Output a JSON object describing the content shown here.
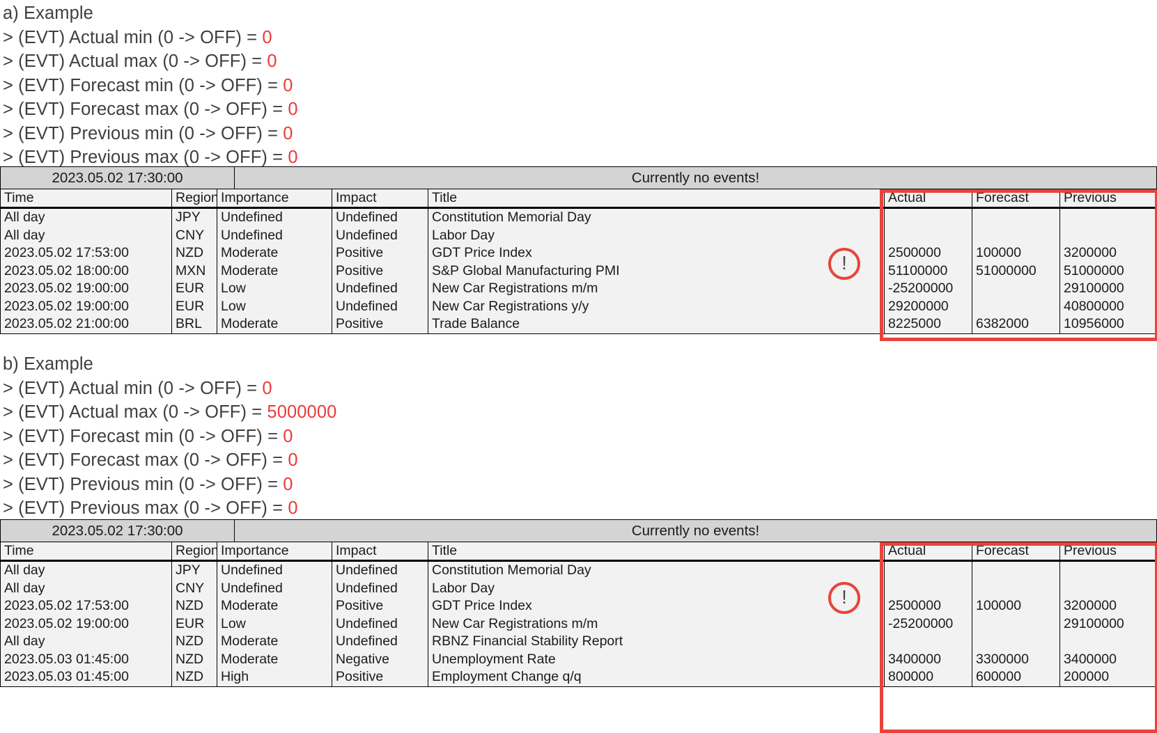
{
  "sections": [
    {
      "caption": "a) Example",
      "loglines": [
        {
          "label": "> (EVT) Actual min (0 -> OFF) = ",
          "value": "0"
        },
        {
          "label": "> (EVT) Actual max (0 -> OFF) = ",
          "value": "0"
        },
        {
          "label": "> (EVT) Forecast min (0 -> OFF) = ",
          "value": "0"
        },
        {
          "label": "> (EVT) Forecast max (0 -> OFF) = ",
          "value": "0"
        },
        {
          "label": "> (EVT) Previous min (0 -> OFF) = ",
          "value": "0"
        },
        {
          "label": "> (EVT) Previous max (0 -> OFF) = ",
          "value": "0"
        }
      ],
      "table": {
        "clock": "2023.05.02 17:30:00",
        "status": "Currently no events!",
        "headers": {
          "time": "Time",
          "region": "Region",
          "importance": "Importance",
          "impact": "Impact",
          "title": "Title",
          "actual": "Actual",
          "forecast": "Forecast",
          "previous": "Previous"
        },
        "rows": [
          {
            "time": "All day",
            "region": "JPY",
            "importance": "Undefined",
            "impact": "Undefined",
            "title": "Constitution Memorial Day",
            "actual": "",
            "forecast": "",
            "previous": ""
          },
          {
            "time": "All day",
            "region": "CNY",
            "importance": "Undefined",
            "impact": "Undefined",
            "title": "Labor Day",
            "actual": "",
            "forecast": "",
            "previous": ""
          },
          {
            "time": "2023.05.02 17:53:00",
            "region": "NZD",
            "importance": "Moderate",
            "impact": "Positive",
            "title": "GDT Price Index",
            "actual": "2500000",
            "forecast": "100000",
            "previous": "3200000"
          },
          {
            "time": "2023.05.02 18:00:00",
            "region": "MXN",
            "importance": "Moderate",
            "impact": "Positive",
            "title": "S&P Global Manufacturing PMI",
            "actual": "51100000",
            "forecast": "51000000",
            "previous": "51000000"
          },
          {
            "time": "2023.05.02 19:00:00",
            "region": "EUR",
            "importance": "Low",
            "impact": "Undefined",
            "title": "New Car Registrations m/m",
            "actual": "-25200000",
            "forecast": "",
            "previous": "29100000"
          },
          {
            "time": "2023.05.02 19:00:00",
            "region": "EUR",
            "importance": "Low",
            "impact": "Undefined",
            "title": "New Car Registrations y/y",
            "actual": "29200000",
            "forecast": "",
            "previous": "40800000"
          },
          {
            "time": "2023.05.02 21:00:00",
            "region": "BRL",
            "importance": "Moderate",
            "impact": "Positive",
            "title": "Trade Balance",
            "actual": "8225000",
            "forecast": "6382000",
            "previous": "10956000"
          }
        ],
        "warning_icon": "warning-exclamation-icon",
        "warning_glyph": "!"
      }
    },
    {
      "caption": "b) Example",
      "loglines": [
        {
          "label": "> (EVT) Actual min (0 -> OFF) = ",
          "value": "0"
        },
        {
          "label": "> (EVT) Actual max (0 -> OFF) = ",
          "value": "5000000"
        },
        {
          "label": "> (EVT) Forecast min (0 -> OFF) = ",
          "value": "0"
        },
        {
          "label": "> (EVT) Forecast max (0 -> OFF) = ",
          "value": "0"
        },
        {
          "label": "> (EVT) Previous min (0 -> OFF) = ",
          "value": "0"
        },
        {
          "label": "> (EVT) Previous max (0 -> OFF) = ",
          "value": "0"
        }
      ],
      "table": {
        "clock": "2023.05.02 17:30:00",
        "status": "Currently no events!",
        "headers": {
          "time": "Time",
          "region": "Region",
          "importance": "Importance",
          "impact": "Impact",
          "title": "Title",
          "actual": "Actual",
          "forecast": "Forecast",
          "previous": "Previous"
        },
        "rows": [
          {
            "time": "All day",
            "region": "JPY",
            "importance": "Undefined",
            "impact": "Undefined",
            "title": "Constitution Memorial Day",
            "actual": "",
            "forecast": "",
            "previous": ""
          },
          {
            "time": "All day",
            "region": "CNY",
            "importance": "Undefined",
            "impact": "Undefined",
            "title": "Labor Day",
            "actual": "",
            "forecast": "",
            "previous": ""
          },
          {
            "time": "2023.05.02 17:53:00",
            "region": "NZD",
            "importance": "Moderate",
            "impact": "Positive",
            "title": "GDT Price Index",
            "actual": "2500000",
            "forecast": "100000",
            "previous": "3200000"
          },
          {
            "time": "2023.05.02 19:00:00",
            "region": "EUR",
            "importance": "Low",
            "impact": "Undefined",
            "title": "New Car Registrations m/m",
            "actual": "-25200000",
            "forecast": "",
            "previous": "29100000"
          },
          {
            "time": "All day",
            "region": "NZD",
            "importance": "Moderate",
            "impact": "Undefined",
            "title": "RBNZ Financial Stability Report",
            "actual": "",
            "forecast": "",
            "previous": ""
          },
          {
            "time": "2023.05.03 01:45:00",
            "region": "NZD",
            "importance": "Moderate",
            "impact": "Negative",
            "title": "Unemployment Rate",
            "actual": "3400000",
            "forecast": "3300000",
            "previous": "3400000"
          },
          {
            "time": "2023.05.03 01:45:00",
            "region": "NZD",
            "importance": "High",
            "impact": "Positive",
            "title": "Employment Change q/q",
            "actual": "800000",
            "forecast": "600000",
            "previous": "200000"
          }
        ],
        "warning_icon": "warning-exclamation-icon",
        "warning_glyph": "!"
      }
    }
  ],
  "colors": {
    "highlight": "#e8443c",
    "log_value": "#ec3a3a",
    "text": "#3f3f3f"
  }
}
